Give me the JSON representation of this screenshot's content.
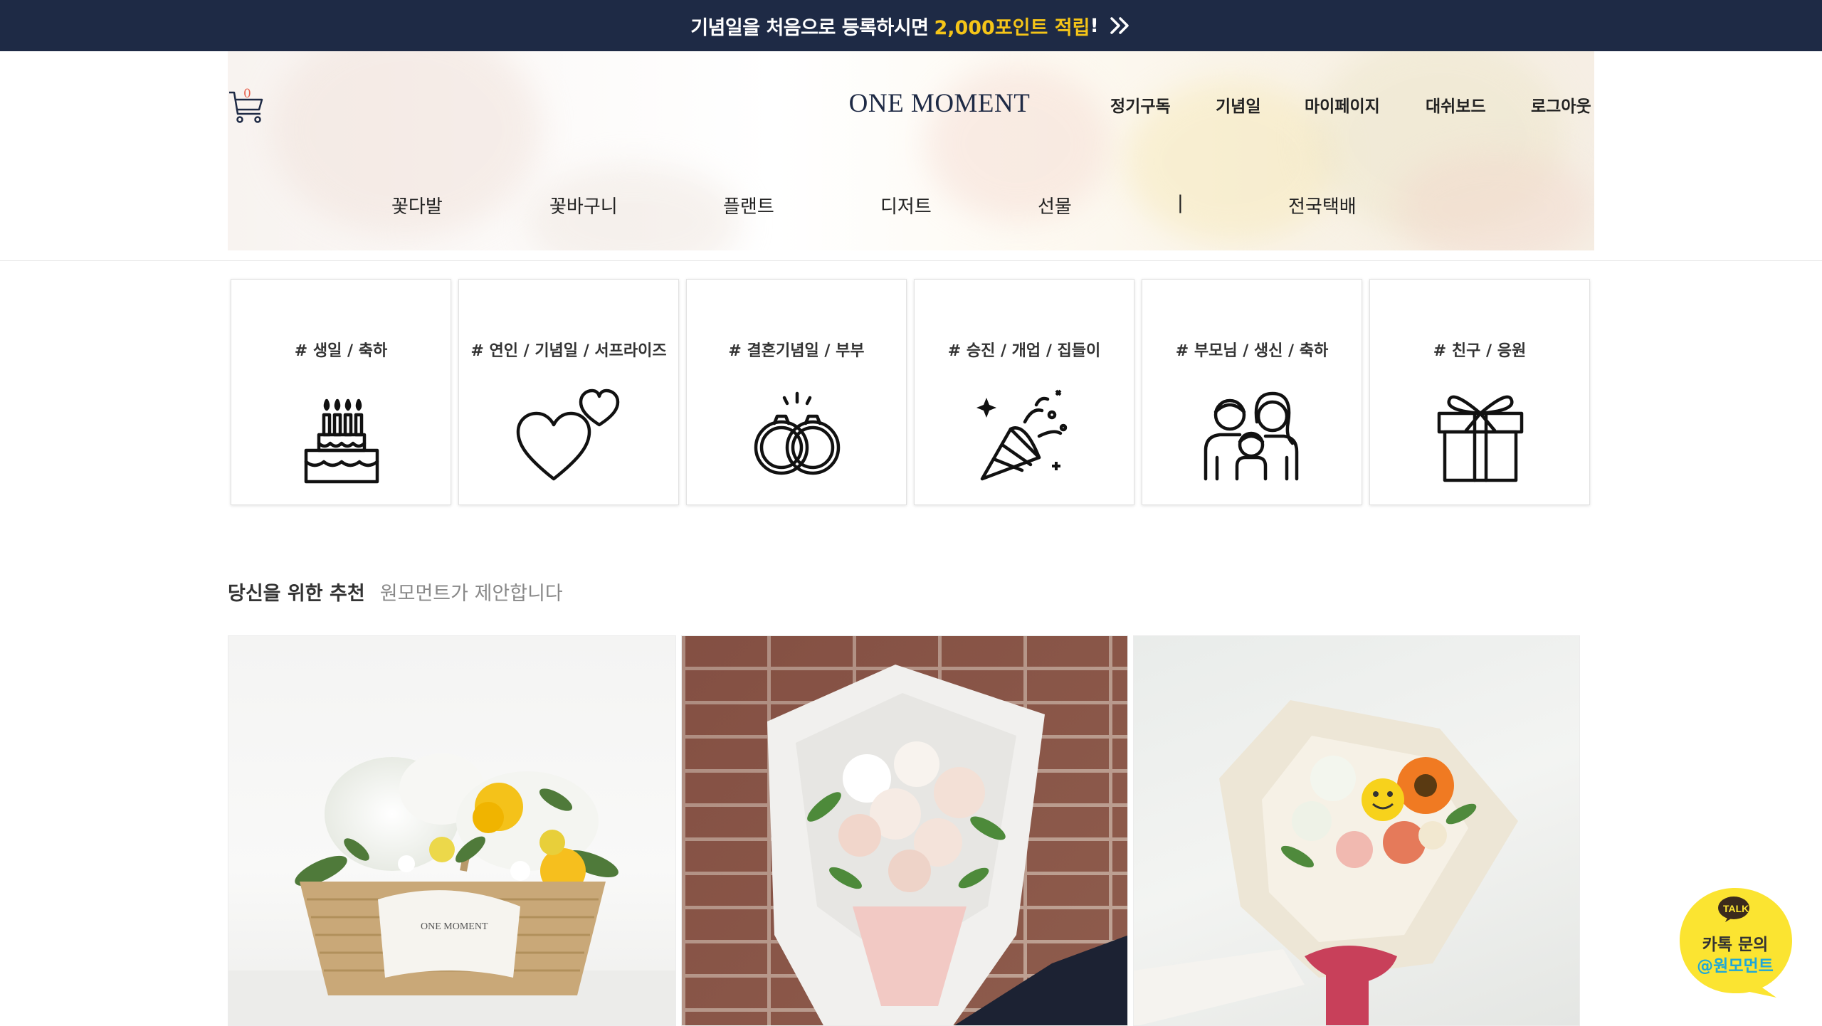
{
  "banner": {
    "text": "기념일을 처음으로 등록하시면",
    "highlight": "2,000포인트 적립",
    "suffix": "!",
    "icon": "double-chevron-right-icon",
    "bg_color": "#1e2a45",
    "highlight_color": "#f5c518"
  },
  "header": {
    "cart_count": "0",
    "logo": "ONE MOMENT",
    "links": [
      "정기구독",
      "기념일",
      "마이페이지",
      "대쉬보드",
      "로그아웃"
    ]
  },
  "nav": {
    "items": [
      "꽃다발",
      "꽃바구니",
      "플랜트",
      "디저트",
      "선물"
    ],
    "separator": "|",
    "extra": "전국택배"
  },
  "categories": [
    {
      "label": "# 생일 / 축하",
      "icon": "birthday-cake-icon"
    },
    {
      "label": "# 연인 / 기념일 / 서프라이즈",
      "icon": "hearts-icon"
    },
    {
      "label": "# 결혼기념일 / 부부",
      "icon": "wedding-rings-icon"
    },
    {
      "label": "# 승진 / 개업 / 집들이",
      "icon": "party-popper-icon"
    },
    {
      "label": "# 부모님 / 생신 / 축하",
      "icon": "family-icon"
    },
    {
      "label": "# 친구 / 응원",
      "icon": "gift-box-icon"
    }
  ],
  "recommend": {
    "title": "당신을 위한 추천",
    "subtitle": "원모먼트가 제안합니다"
  },
  "products": [
    {
      "name": "basket-arrangement-image",
      "ribbon": "ONE MOMENT"
    },
    {
      "name": "white-bouquet-image"
    },
    {
      "name": "smiley-bouquet-image"
    }
  ],
  "kakao": {
    "badge": "TALK",
    "line1": "카톡 문의",
    "line2_prefix": "@",
    "line2": "원모먼트",
    "color": "#fbe431"
  }
}
